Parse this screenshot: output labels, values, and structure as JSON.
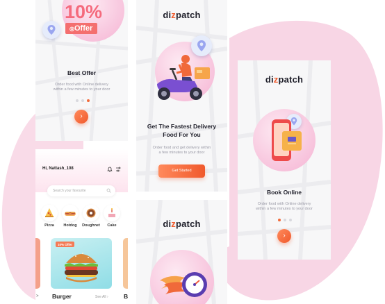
{
  "brand": {
    "logo": "dizpatch",
    "accent": "#f05a2c",
    "pink": "#f7b8d6"
  },
  "screen_offer": {
    "badge_big": "10%",
    "badge_small": "Offer",
    "title": "Best Offer",
    "subtitle_line1": "Order food with Online  delivery",
    "subtitle_line2": "within a few minutes to your door",
    "active_dot": 3,
    "next_icon": "chevron-right-icon"
  },
  "screen_delivery": {
    "logo": "dizpatch",
    "title_line1": "Get The Fastest Delivery",
    "title_line2": "Food For You",
    "subtitle_line1": "Order food and get delivery within",
    "subtitle_line2": "a few minutes to your door",
    "button_label": "Get Started"
  },
  "screen_book": {
    "logo": "dizpatch",
    "title": "Book Online",
    "subtitle_line1": "Order food with Online  delivery",
    "subtitle_line2": "within a few minutes to your door",
    "active_dot": 1,
    "next_icon": "chevron-right-icon"
  },
  "screen_home": {
    "greeting": "Hi, Nattash_108",
    "search_placeholder": "Search your favourite",
    "categories": [
      {
        "label": "Pizza",
        "icon": "pizza-icon"
      },
      {
        "label": "Hotdog",
        "icon": "hotdog-icon"
      },
      {
        "label": "Doughnet",
        "icon": "doughnut-icon"
      },
      {
        "label": "Cake",
        "icon": "cake-icon"
      }
    ],
    "card_badge": "10% Offer",
    "section_title": "Burger",
    "see_all": "See All",
    "next_section_initial": "B",
    "prev_arrow": ">"
  },
  "screen_speed": {
    "logo": "dizpatch"
  }
}
